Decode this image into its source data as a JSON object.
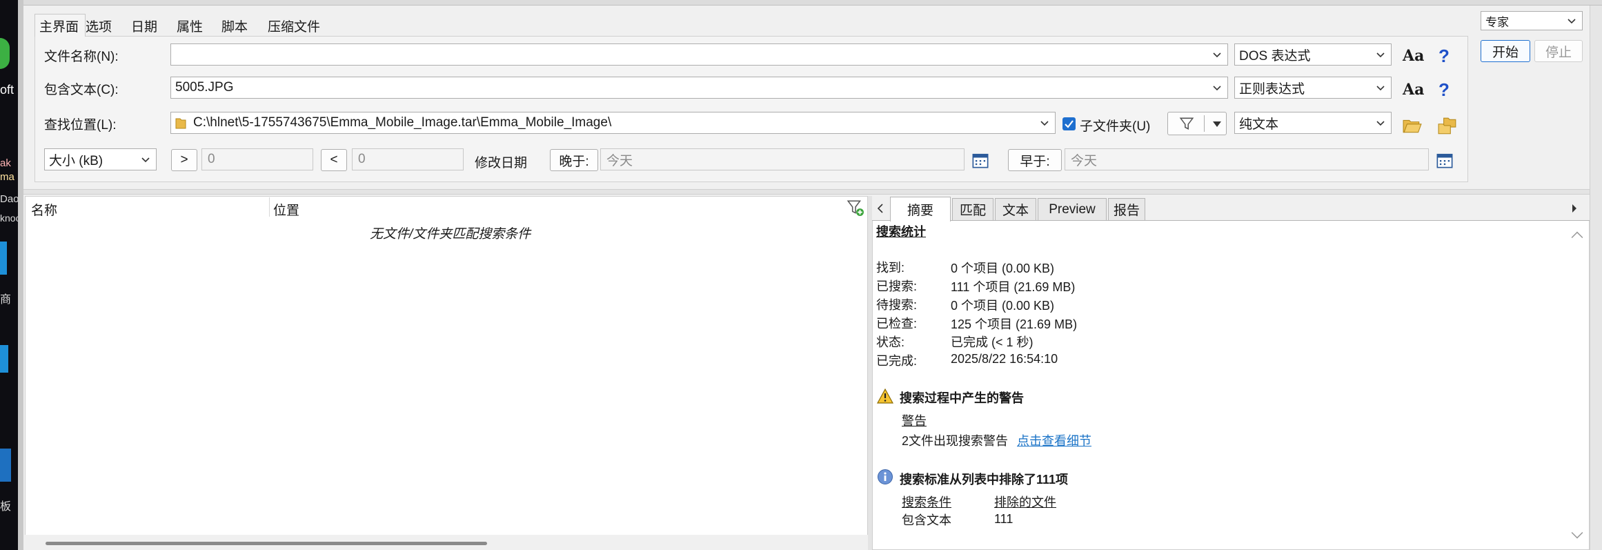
{
  "tabs": [
    {
      "label": "主界面",
      "active": true
    },
    {
      "label": "选项"
    },
    {
      "label": "日期"
    },
    {
      "label": "属性"
    },
    {
      "label": "脚本"
    },
    {
      "label": "压缩文件"
    }
  ],
  "mode": {
    "selected": "专家",
    "start_label": "开始",
    "stop_label": "停止"
  },
  "left_bg_fragments": [
    "oft",
    "ak",
    "ma",
    "ma",
    "Dao",
    "knoc",
    "商",
    "板"
  ],
  "form": {
    "filename_label": "文件名称(N):",
    "filename_value": "",
    "filename_syntax": "DOS 表达式",
    "contains_label": "包含文本(C):",
    "contains_value": "5005.JPG",
    "contains_syntax": "正则表达式",
    "location_label": "查找位置(L):",
    "location_value": "C:\\hlnet\\5-1755743675\\Emma_Mobile_Image.tar\\Emma_Mobile_Image\\",
    "subfolders_label": "子文件夹(U)",
    "subfolders_checked": true,
    "text_type": "纯文本",
    "aa_label": "Aa",
    "help_label": "?",
    "size_select": "大小 (kB)",
    "gt_label": ">",
    "gt_value": "0",
    "lt_label": "<",
    "lt_value": "0",
    "modified_label": "修改日期",
    "after_label": "晚于:",
    "after_value": "今天",
    "before_label": "早于:",
    "before_value": "今天"
  },
  "results": {
    "col_name": "名称",
    "col_location": "位置",
    "empty_message": "无文件/文件夹匹配搜索条件"
  },
  "right_tabs": [
    "摘要",
    "匹配",
    "文本",
    "Preview",
    "报告"
  ],
  "summary": {
    "title": "搜索统计",
    "rows": [
      {
        "k": "找到:",
        "v": "0 个项目  (0.00 KB)"
      },
      {
        "k": "已搜索:",
        "v": "111 个项目  (21.69 MB)"
      },
      {
        "k": "待搜索:",
        "v": "0 个项目  (0.00 KB)"
      },
      {
        "k": "已检查:",
        "v": "125 个项目  (21.69 MB)"
      },
      {
        "k": "状态:",
        "v": "已完成  (< 1 秒)"
      },
      {
        "k": "已完成:",
        "v": "2025/8/22 16:54:10"
      }
    ],
    "warning_title": "搜索过程中产生的警告",
    "warning_sub": "警告",
    "warning_text": "2文件出现搜索警告",
    "warning_link": "点击查看细节",
    "info_title": "搜索标准从列表中排除了111项",
    "col_criteria": "搜索条件",
    "col_excluded": "排除的文件",
    "crit_name": "包含文本",
    "crit_value": "111"
  },
  "colors": {
    "accent": "#1e6fcf",
    "link": "#1a73c7",
    "help": "#1e50c8"
  }
}
